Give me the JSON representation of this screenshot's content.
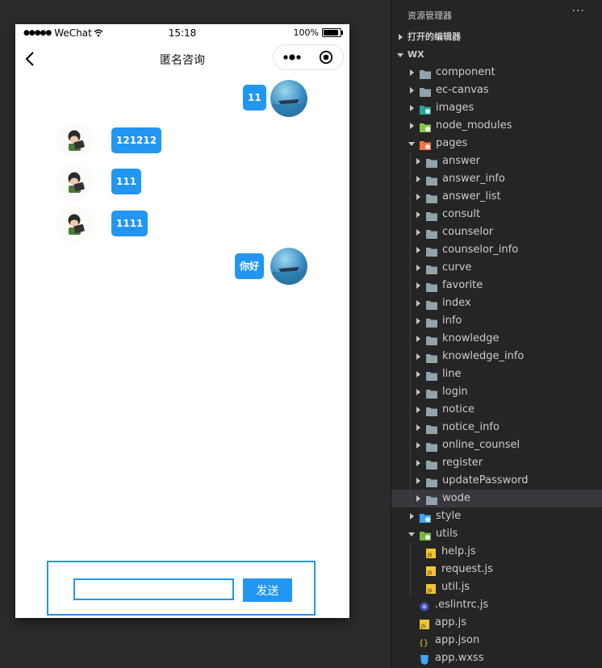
{
  "phone": {
    "status": {
      "carrier": "WeChat",
      "time": "15:18",
      "battery": "100%",
      "battery_level": 1.0
    },
    "nav": {
      "title": "匿名咨询"
    },
    "messages": [
      {
        "side": "right",
        "text": "11"
      },
      {
        "side": "left",
        "text": "121212"
      },
      {
        "side": "left",
        "text": "111"
      },
      {
        "side": "left",
        "text": "1111"
      },
      {
        "side": "right",
        "text": "你好"
      }
    ],
    "input": {
      "value": "",
      "placeholder": ""
    },
    "send_label": "发送"
  },
  "explorer": {
    "title": "资源管理器",
    "more_icon": "ellipsis",
    "tree": [
      {
        "label": "打开的编辑器",
        "type": "section",
        "depth": 0,
        "expanded": false
      },
      {
        "label": "WX",
        "type": "section",
        "depth": 0,
        "expanded": true
      },
      {
        "label": "component",
        "type": "folder",
        "depth": 1,
        "expanded": false,
        "icon": "folder-icon"
      },
      {
        "label": "ec-canvas",
        "type": "folder",
        "depth": 1,
        "expanded": false,
        "icon": "folder-icon"
      },
      {
        "label": "images",
        "type": "folder",
        "depth": 1,
        "expanded": false,
        "icon": "images-folder-icon"
      },
      {
        "label": "node_modules",
        "type": "folder",
        "depth": 1,
        "expanded": false,
        "icon": "node-folder-icon"
      },
      {
        "label": "pages",
        "type": "folder",
        "depth": 1,
        "expanded": true,
        "icon": "pages-folder-icon"
      },
      {
        "label": "answer",
        "type": "folder",
        "depth": 2,
        "expanded": false,
        "icon": "folder-icon"
      },
      {
        "label": "answer_info",
        "type": "folder",
        "depth": 2,
        "expanded": false,
        "icon": "folder-icon"
      },
      {
        "label": "answer_list",
        "type": "folder",
        "depth": 2,
        "expanded": false,
        "icon": "folder-icon"
      },
      {
        "label": "consult",
        "type": "folder",
        "depth": 2,
        "expanded": false,
        "icon": "folder-icon"
      },
      {
        "label": "counselor",
        "type": "folder",
        "depth": 2,
        "expanded": false,
        "icon": "folder-icon"
      },
      {
        "label": "counselor_info",
        "type": "folder",
        "depth": 2,
        "expanded": false,
        "icon": "folder-icon"
      },
      {
        "label": "curve",
        "type": "folder",
        "depth": 2,
        "expanded": false,
        "icon": "folder-icon"
      },
      {
        "label": "favorite",
        "type": "folder",
        "depth": 2,
        "expanded": false,
        "icon": "folder-icon"
      },
      {
        "label": "index",
        "type": "folder",
        "depth": 2,
        "expanded": false,
        "icon": "folder-icon"
      },
      {
        "label": "info",
        "type": "folder",
        "depth": 2,
        "expanded": false,
        "icon": "folder-icon"
      },
      {
        "label": "knowledge",
        "type": "folder",
        "depth": 2,
        "expanded": false,
        "icon": "folder-icon"
      },
      {
        "label": "knowledge_info",
        "type": "folder",
        "depth": 2,
        "expanded": false,
        "icon": "folder-icon"
      },
      {
        "label": "line",
        "type": "folder",
        "depth": 2,
        "expanded": false,
        "icon": "folder-icon"
      },
      {
        "label": "login",
        "type": "folder",
        "depth": 2,
        "expanded": false,
        "icon": "folder-icon"
      },
      {
        "label": "notice",
        "type": "folder",
        "depth": 2,
        "expanded": false,
        "icon": "folder-icon"
      },
      {
        "label": "notice_info",
        "type": "folder",
        "depth": 2,
        "expanded": false,
        "icon": "folder-icon"
      },
      {
        "label": "online_counsel",
        "type": "folder",
        "depth": 2,
        "expanded": false,
        "icon": "folder-icon"
      },
      {
        "label": "register",
        "type": "folder",
        "depth": 2,
        "expanded": false,
        "icon": "folder-icon"
      },
      {
        "label": "updatePassword",
        "type": "folder",
        "depth": 2,
        "expanded": false,
        "icon": "folder-icon"
      },
      {
        "label": "wode",
        "type": "folder",
        "depth": 2,
        "expanded": false,
        "icon": "folder-icon",
        "selected": true
      },
      {
        "label": "style",
        "type": "folder",
        "depth": 1,
        "expanded": false,
        "icon": "style-folder-icon"
      },
      {
        "label": "utils",
        "type": "folder",
        "depth": 1,
        "expanded": true,
        "icon": "utils-folder-icon"
      },
      {
        "label": "help.js",
        "type": "file",
        "depth": 2,
        "icon": "js-file-icon"
      },
      {
        "label": "request.js",
        "type": "file",
        "depth": 2,
        "icon": "js-file-icon"
      },
      {
        "label": "util.js",
        "type": "file",
        "depth": 2,
        "icon": "js-file-icon"
      },
      {
        "label": ".eslintrc.js",
        "type": "file",
        "depth": 1,
        "icon": "eslint-file-icon"
      },
      {
        "label": "app.js",
        "type": "file",
        "depth": 1,
        "icon": "js-file-icon"
      },
      {
        "label": "app.json",
        "type": "file",
        "depth": 1,
        "icon": "json-file-icon"
      },
      {
        "label": "app.wxss",
        "type": "file",
        "depth": 1,
        "icon": "css-file-icon"
      }
    ]
  },
  "colors": {
    "accent": "#2196f3",
    "editor_bg": "#2b2b2b",
    "sidebar_bg": "#252526",
    "selected_row": "#37373d",
    "folder": "#90a4ae"
  }
}
